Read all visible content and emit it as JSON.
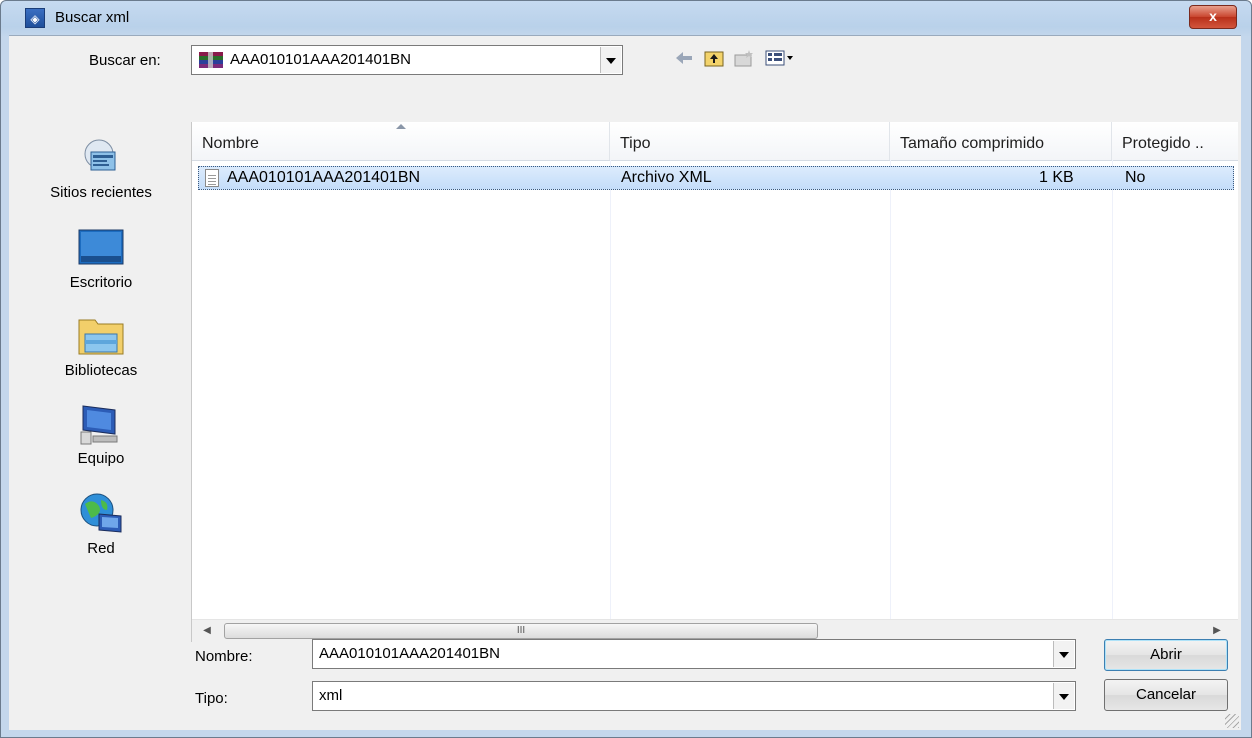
{
  "window": {
    "title": "Buscar xml",
    "close_label": "x"
  },
  "toolbar": {
    "lookin_label": "Buscar en:",
    "lookin_value": "AAA010101AAA201401BN"
  },
  "places": [
    {
      "label": "Sitios recientes",
      "icon": "recent-places-icon"
    },
    {
      "label": "Escritorio",
      "icon": "desktop-icon"
    },
    {
      "label": "Bibliotecas",
      "icon": "libraries-icon"
    },
    {
      "label": "Equipo",
      "icon": "computer-icon"
    },
    {
      "label": "Red",
      "icon": "network-icon"
    }
  ],
  "list": {
    "columns": [
      "Nombre",
      "Tipo",
      "Tamaño comprimido",
      "Protegido .."
    ],
    "rows": [
      {
        "name": "AAA010101AAA201401BN",
        "type": "Archivo XML",
        "size": "1 KB",
        "protected": "No"
      }
    ],
    "scroll_glyph": "III"
  },
  "bottom": {
    "name_label": "Nombre:",
    "name_value": "AAA010101AAA201401BN",
    "type_label": "Tipo:",
    "type_value": "xml",
    "open_label": "Abrir",
    "cancel_label": "Cancelar"
  },
  "colors": {
    "accent": "#c4ddfa",
    "title_gradient": "#b9d1ea",
    "close": "#c9452e"
  }
}
